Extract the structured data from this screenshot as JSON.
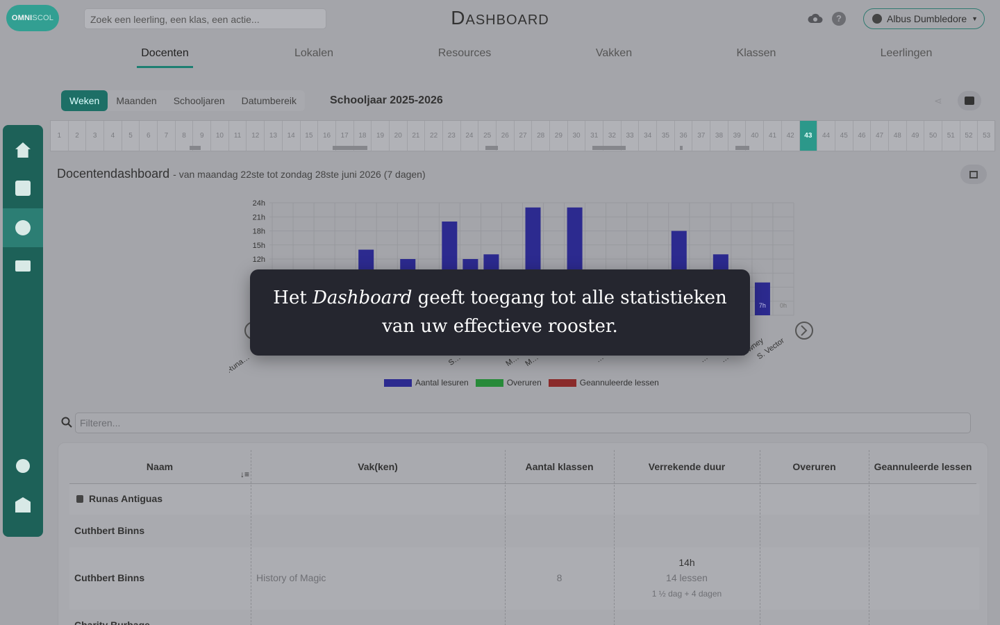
{
  "header": {
    "logo_bold": "OMNI",
    "logo_light": "SCOL",
    "search_placeholder": "Zoek een leerling, een klas, een actie...",
    "title": "Dashboard",
    "user_name": "Albus Dumbledore"
  },
  "tabs": [
    {
      "label": "Docenten",
      "active": true
    },
    {
      "label": "Lokalen",
      "active": false
    },
    {
      "label": "Resources",
      "active": false
    },
    {
      "label": "Vakken",
      "active": false
    },
    {
      "label": "Klassen",
      "active": false
    },
    {
      "label": "Leerlingen",
      "active": false
    }
  ],
  "period_selector": {
    "options": [
      "Weken",
      "Maanden",
      "Schooljaren",
      "Datumbereik"
    ],
    "selected": "Weken",
    "schoolyear": "Schooljaar 2025-2026"
  },
  "weeks": {
    "labels": [
      "1",
      "2",
      "3",
      "4",
      "5",
      "6",
      "7",
      "8",
      "9",
      "10",
      "11",
      "12",
      "13",
      "14",
      "15",
      "16",
      "17",
      "18",
      "19",
      "20",
      "21",
      "22",
      "23",
      "24",
      "25",
      "26",
      "27",
      "28",
      "29",
      "30",
      "31",
      "32",
      "33",
      "34",
      "35",
      "36",
      "37",
      "38",
      "39",
      "40",
      "41",
      "42",
      "43",
      "44",
      "45",
      "46",
      "47",
      "48",
      "49",
      "50",
      "51",
      "52",
      "53"
    ],
    "selected": "43"
  },
  "section": {
    "title": "Docentendashboard",
    "subtitle": "- van maandag 22ste tot zondag 28ste juni 2026 (7 dagen)"
  },
  "chart_data": {
    "type": "bar",
    "ylim": [
      0,
      24
    ],
    "yticks": [
      "24h",
      "21h",
      "18h",
      "15h",
      "12h"
    ],
    "categories_visible": [
      "Runa…",
      "S…",
      "M…",
      "M…",
      "…",
      "…",
      "…",
      "…wney",
      "S. Vector"
    ],
    "series": [
      {
        "name": "Aantal lesuren",
        "color": "#2c2a8f",
        "values": [
          14,
          12,
          20,
          12,
          13,
          23,
          23,
          18,
          13,
          7,
          0
        ]
      }
    ],
    "data_labels": [
      "7h",
      "0h"
    ],
    "legend": [
      "Aantal lesuren",
      "Overuren",
      "Geannuleerde lessen"
    ],
    "legend_colors": [
      "#2c2a8f",
      "#278a39",
      "#8a2a2a"
    ]
  },
  "filter": {
    "placeholder": "Filteren..."
  },
  "table": {
    "headers": [
      "Naam",
      "Vak(ken)",
      "Aantal klassen",
      "Verrekende duur",
      "Overuren",
      "Geannuleerde lessen"
    ],
    "rows": [
      {
        "naam": "Runas Antiguas",
        "locked": true
      },
      {
        "naam": "Cuthbert Binns"
      },
      {
        "naam": "Cuthbert Binns",
        "vak": "History of Magic",
        "klassen": "8",
        "duur": "14h",
        "lessen": "14 lessen",
        "detail": "1 ½ dag + 4 dagen"
      },
      {
        "naam": "Charity Burbage"
      }
    ]
  },
  "tooltip": {
    "line1_pre": "Het ",
    "line1_em": "Dashboard",
    "line1_post": " geeft toegang tot alle statistieken",
    "line2": "van uw effectieve rooster."
  }
}
